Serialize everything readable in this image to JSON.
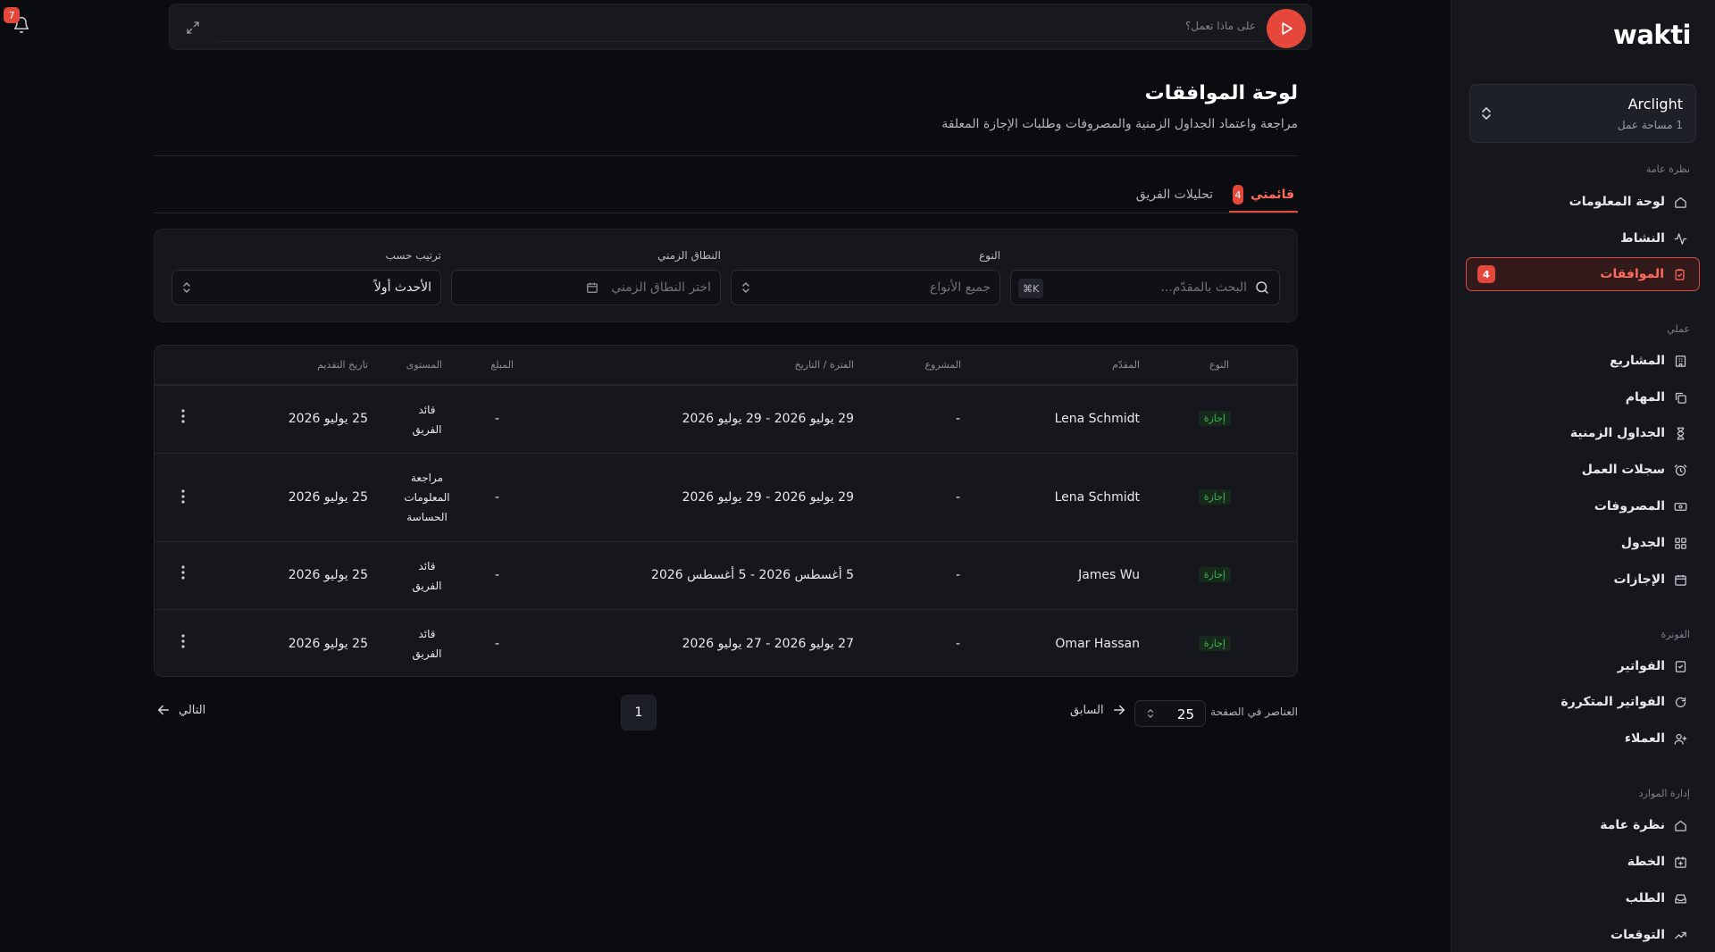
{
  "app": {
    "logo": "wakti",
    "notifications_count": "7"
  },
  "topbar": {
    "prompt": "على ماذا تعمل؟"
  },
  "workspace": {
    "name": "Arclight",
    "sub": "1 مساحة عمل"
  },
  "sidebar": {
    "sections": {
      "overview": "نظرة عامة",
      "my_work": "عملي",
      "billing": "الفوترة",
      "resources": "إدارة الموارد"
    },
    "items": {
      "dashboard": "لوحة المعلومات",
      "activity": "النشاط",
      "approvals": "الموافقات",
      "approvals_badge": "4",
      "projects": "المشاريع",
      "tasks": "المهام",
      "timesheets": "الجداول الزمنية",
      "worklogs": "سجلات العمل",
      "expenses": "المصروفات",
      "schedule": "الجدول",
      "leaves": "الإجازات",
      "invoices": "الفواتير",
      "recurring_invoices": "الفواتير المتكررة",
      "clients": "العملاء",
      "res_overview": "نظرة عامة",
      "plan": "الخطة",
      "request": "الطلب",
      "forecasts": "التوقعات"
    }
  },
  "header": {
    "title": "لوحة الموافقات",
    "subtitle": "مراجعة واعتماد الجداول الزمنية والمصروفات وطلبات الإجازة المعلقة"
  },
  "tabs": {
    "my_list": "قائمتي",
    "my_list_count": "4",
    "team_analytics": "تحليلات الفريق"
  },
  "filters": {
    "search_placeholder": "البحث بالمقدّم...",
    "kbd": "⌘K",
    "type_label": "النوع",
    "type_value": "جميع الأنواع",
    "range_label": "النطاق الزمني",
    "range_placeholder": "اختر النطاق الزمني",
    "sort_label": "ترتيب حسب",
    "sort_value": "الأحدث أولاً"
  },
  "table": {
    "columns": {
      "type": "النوع",
      "submitter": "المقدّم",
      "project": "المشروع",
      "period": "الفترة / التاريخ",
      "amount": "المبلغ",
      "level": "المستوى",
      "submitted": "تاريخ التقديم"
    },
    "rows": [
      {
        "type": "إجازة",
        "submitter": "Lena Schmidt",
        "project": "-",
        "period": "29 يوليو 2026 - 29 يوليو 2026",
        "amount": "-",
        "level_lines": [
          "قائد",
          "الفريق"
        ],
        "submitted": "25 يوليو 2026"
      },
      {
        "type": "إجازة",
        "submitter": "Lena Schmidt",
        "project": "-",
        "period": "29 يوليو 2026 - 29 يوليو 2026",
        "amount": "-",
        "level_lines": [
          "مراجعة",
          "المعلومات",
          "الحساسة"
        ],
        "submitted": "25 يوليو 2026"
      },
      {
        "type": "إجازة",
        "submitter": "James Wu",
        "project": "-",
        "period": "5 أغسطس 2026 - 5 أغسطس 2026",
        "amount": "-",
        "level_lines": [
          "قائد",
          "الفريق"
        ],
        "submitted": "25 يوليو 2026"
      },
      {
        "type": "إجازة",
        "submitter": "Omar Hassan",
        "project": "-",
        "period": "27 يوليو 2026 - 27 يوليو 2026",
        "amount": "-",
        "level_lines": [
          "قائد",
          "الفريق"
        ],
        "submitted": "25 يوليو 2026"
      }
    ]
  },
  "pagination": {
    "per_page_label": "العناصر في الصفحة",
    "per_page": "25",
    "prev": "السابق",
    "next": "التالي",
    "page": "1"
  }
}
